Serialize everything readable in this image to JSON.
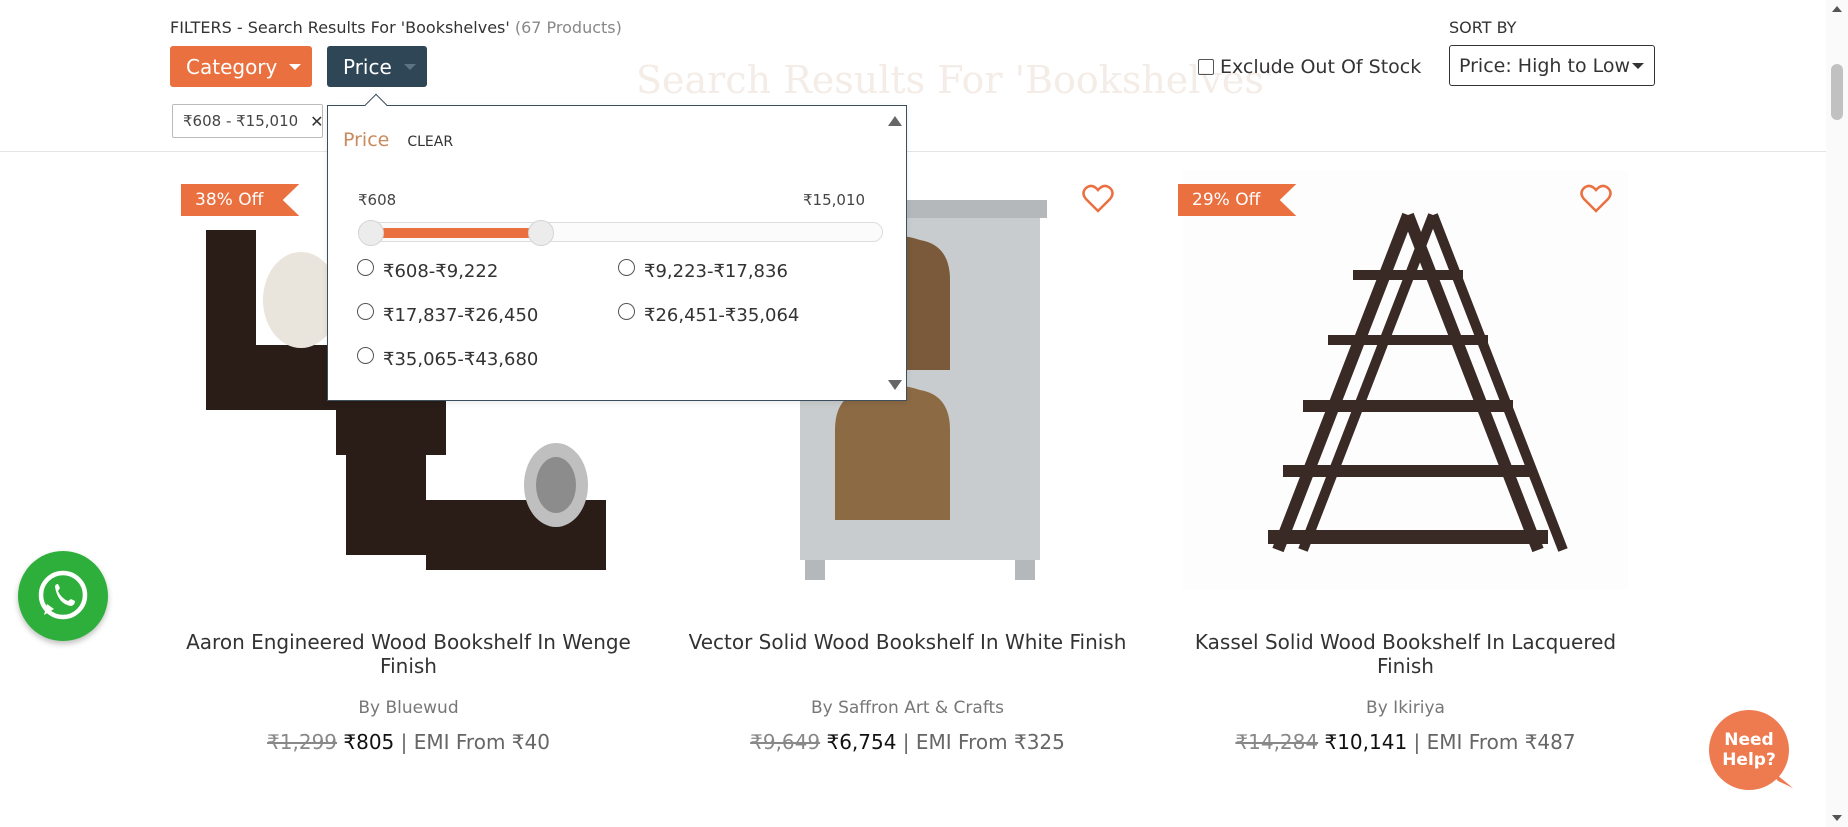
{
  "page": {
    "background_title": "Search Results For 'Bookshelves'"
  },
  "filters": {
    "heading": "FILTERS - Search Results For 'Bookshelves'",
    "product_count": "(67 Products)",
    "category_label": "Category",
    "price_label": "Price",
    "active_chip": "₹608 - ₹15,010",
    "chip_remove": "✕",
    "exclude_out_of_stock": "Exclude Out Of Stock",
    "exclude_checked": false
  },
  "sort": {
    "label": "SORT BY",
    "selected": "Price: High to Low"
  },
  "price_dropdown": {
    "title": "Price",
    "clear": "CLEAR",
    "range_min_label": "₹608",
    "range_max_label": "₹15,010",
    "selected_fraction_low": 0.0,
    "selected_fraction_high": 0.34,
    "options": [
      "₹608-₹9,222",
      "₹9,223-₹17,836",
      "₹17,837-₹26,450",
      "₹26,451-₹35,064",
      "₹35,065-₹43,680"
    ]
  },
  "products": [
    {
      "discount": "38% Off",
      "title": "Aaron Engineered Wood Bookshelf In Wenge Finish",
      "brand": "By Bluewud",
      "mrp": "₹1,299",
      "price": "₹805",
      "emi": " | EMI From ₹40"
    },
    {
      "discount": "",
      "title": "Vector Solid Wood Bookshelf In White Finish",
      "brand": "By Saffron Art & Crafts",
      "mrp": "₹9,649",
      "price": "₹6,754",
      "emi": " | EMI From ₹325"
    },
    {
      "discount": "29% Off",
      "title": "Kassel Solid Wood Bookshelf In Lacquered Finish",
      "brand": "By Ikiriya",
      "mrp": "₹14,284",
      "price": "₹10,141",
      "emi": " | EMI From ₹487"
    }
  ],
  "help": {
    "label_line1": "Need",
    "label_line2": "Help?"
  },
  "colors": {
    "accent": "#ea7040",
    "price_button": "#2f4656",
    "whatsapp": "#2eae3a"
  }
}
